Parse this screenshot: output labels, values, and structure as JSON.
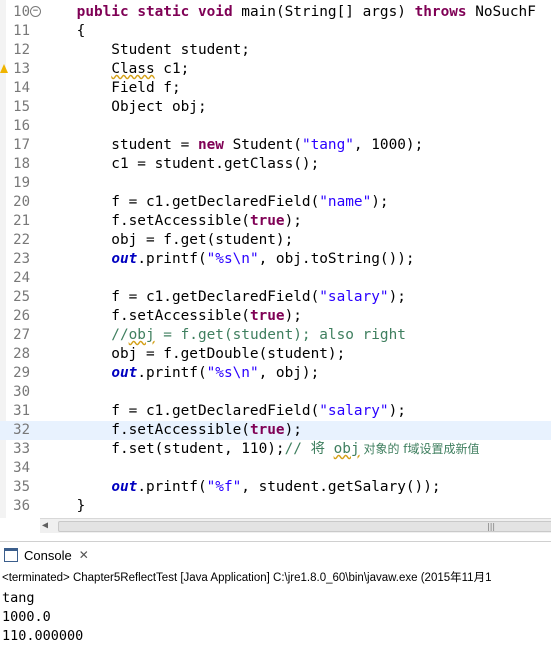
{
  "editor": {
    "lines": [
      {
        "num": "10",
        "fold": true,
        "tokens": [
          [
            "plain",
            "    "
          ],
          [
            "kw",
            "public"
          ],
          [
            "plain",
            " "
          ],
          [
            "kw",
            "static"
          ],
          [
            "plain",
            " "
          ],
          [
            "kw",
            "void"
          ],
          [
            "plain",
            " main(String[] "
          ],
          [
            "plain",
            "args"
          ],
          [
            "plain",
            ") "
          ],
          [
            "kw",
            "throws"
          ],
          [
            "plain",
            " NoSuchF"
          ]
        ]
      },
      {
        "num": "11",
        "tokens": [
          [
            "plain",
            "    {"
          ]
        ]
      },
      {
        "num": "12",
        "tokens": [
          [
            "plain",
            "        Student "
          ],
          [
            "plain",
            "student"
          ],
          [
            "plain",
            ";"
          ]
        ]
      },
      {
        "num": "13",
        "warn": true,
        "tokens": [
          [
            "plain",
            "        "
          ],
          [
            "warn",
            "Class"
          ],
          [
            "plain",
            " c1;"
          ]
        ]
      },
      {
        "num": "14",
        "tokens": [
          [
            "plain",
            "        Field f;"
          ]
        ]
      },
      {
        "num": "15",
        "tokens": [
          [
            "plain",
            "        Object "
          ],
          [
            "plain",
            "obj"
          ],
          [
            "plain",
            ";"
          ]
        ]
      },
      {
        "num": "16",
        "tokens": []
      },
      {
        "num": "17",
        "tokens": [
          [
            "plain",
            "        student = "
          ],
          [
            "kw",
            "new"
          ],
          [
            "plain",
            " Student("
          ],
          [
            "str",
            "\"tang\""
          ],
          [
            "plain",
            ", 1000);"
          ]
        ]
      },
      {
        "num": "18",
        "tokens": [
          [
            "plain",
            "        c1 = student.getClass();"
          ]
        ]
      },
      {
        "num": "19",
        "tokens": []
      },
      {
        "num": "20",
        "tokens": [
          [
            "plain",
            "        f = c1.getDeclaredField("
          ],
          [
            "str",
            "\"name\""
          ],
          [
            "plain",
            ");"
          ]
        ]
      },
      {
        "num": "21",
        "tokens": [
          [
            "plain",
            "        f.setAccessible("
          ],
          [
            "kw",
            "true"
          ],
          [
            "plain",
            ");"
          ]
        ]
      },
      {
        "num": "22",
        "tokens": [
          [
            "plain",
            "        obj = f.get(student);"
          ]
        ]
      },
      {
        "num": "23",
        "tokens": [
          [
            "plain",
            "        "
          ],
          [
            "sfld",
            "out"
          ],
          [
            "plain",
            ".printf("
          ],
          [
            "str",
            "\"%s\\n\""
          ],
          [
            "plain",
            ", obj.toString());"
          ]
        ]
      },
      {
        "num": "24",
        "tokens": []
      },
      {
        "num": "25",
        "tokens": [
          [
            "plain",
            "        f = c1.getDeclaredField("
          ],
          [
            "str",
            "\"salary\""
          ],
          [
            "plain",
            ");"
          ]
        ]
      },
      {
        "num": "26",
        "tokens": [
          [
            "plain",
            "        f.setAccessible("
          ],
          [
            "kw",
            "true"
          ],
          [
            "plain",
            ");"
          ]
        ]
      },
      {
        "num": "27",
        "tokens": [
          [
            "cmt",
            "        //"
          ],
          [
            "cmtwarn",
            "obj"
          ],
          [
            "cmt",
            " = f.get(student); also right"
          ]
        ]
      },
      {
        "num": "28",
        "tokens": [
          [
            "plain",
            "        obj = f.getDouble(student);"
          ]
        ]
      },
      {
        "num": "29",
        "tokens": [
          [
            "plain",
            "        "
          ],
          [
            "sfld",
            "out"
          ],
          [
            "plain",
            ".printf("
          ],
          [
            "str",
            "\"%s\\n\""
          ],
          [
            "plain",
            ", obj);"
          ]
        ]
      },
      {
        "num": "30",
        "tokens": []
      },
      {
        "num": "31",
        "tokens": [
          [
            "plain",
            "        f = c1.getDeclaredField("
          ],
          [
            "str",
            "\"salary\""
          ],
          [
            "plain",
            ");"
          ]
        ]
      },
      {
        "num": "32",
        "current": true,
        "tokens": [
          [
            "plain",
            "        f.setAccessible("
          ],
          [
            "kw",
            "true"
          ],
          [
            "plain",
            ");"
          ]
        ]
      },
      {
        "num": "33",
        "tokens": [
          [
            "plain",
            "        f.set(student, 110);"
          ],
          [
            "cmt",
            "// 将 "
          ],
          [
            "cmtwarn",
            "obj"
          ],
          [
            "cmtcjk",
            " 对象的 f域设置成新值"
          ]
        ]
      },
      {
        "num": "34",
        "tokens": []
      },
      {
        "num": "35",
        "tokens": [
          [
            "plain",
            "        "
          ],
          [
            "sfld",
            "out"
          ],
          [
            "plain",
            ".printf("
          ],
          [
            "str",
            "\"%f\""
          ],
          [
            "plain",
            ", student.getSalary());"
          ]
        ]
      },
      {
        "num": "36",
        "tokens": [
          [
            "plain",
            "    }"
          ]
        ]
      }
    ]
  },
  "console": {
    "tab_label": "Console",
    "close_glyph": "✕",
    "status": "<terminated> Chapter5ReflectTest [Java Application] C:\\jre1.8.0_60\\bin\\javaw.exe (2015年11月1",
    "output": [
      "tang",
      "1000.0",
      "110.000000"
    ]
  },
  "scrollbar": {
    "left_arrow": "◀",
    "grip": "|||"
  }
}
